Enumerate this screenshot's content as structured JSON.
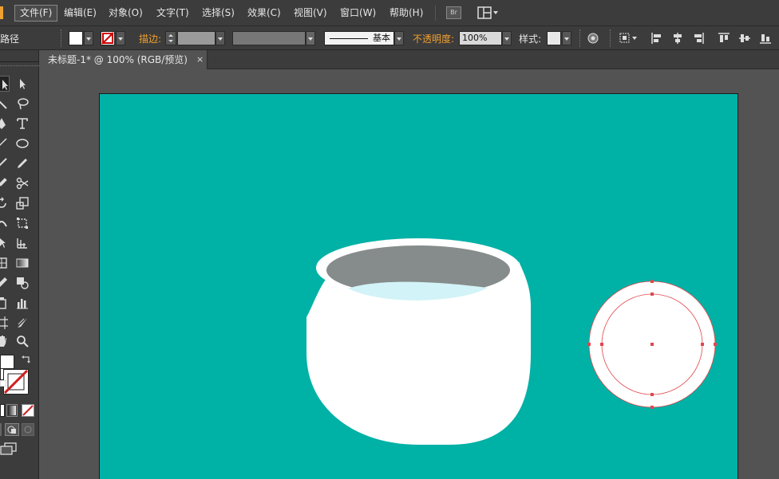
{
  "menubar": {
    "items": [
      {
        "label": "文件(F)",
        "active": true
      },
      {
        "label": "编辑(E)"
      },
      {
        "label": "对象(O)"
      },
      {
        "label": "文字(T)"
      },
      {
        "label": "选择(S)"
      },
      {
        "label": "效果(C)"
      },
      {
        "label": "视图(V)"
      },
      {
        "label": "窗口(W)"
      },
      {
        "label": "帮助(H)"
      }
    ],
    "bridge_icon": "Br",
    "workspace_icon": "workspace-switcher-icon"
  },
  "controlbar": {
    "selection_label": "路径",
    "fill_color": "#ffffff",
    "stroke_label": "描边:",
    "stroke_style_label": "基本",
    "opacity_label": "不透明度:",
    "opacity_value": "100%",
    "style_label": "样式:"
  },
  "document": {
    "tab_title": "未标题-1* @ 100% (RGB/预览)",
    "tab_close": "×"
  },
  "artwork": {
    "background_color": "#00b1a6",
    "bowl_color": "#ffffff",
    "bowl_inner_color": "#868c8b",
    "water_color": "#d2f3f7",
    "selection_color": "#e0474c"
  },
  "colors": {
    "ui_dark": "#3c3c3c",
    "ui_mid": "#535353",
    "accent_orange": "#f0a030"
  }
}
